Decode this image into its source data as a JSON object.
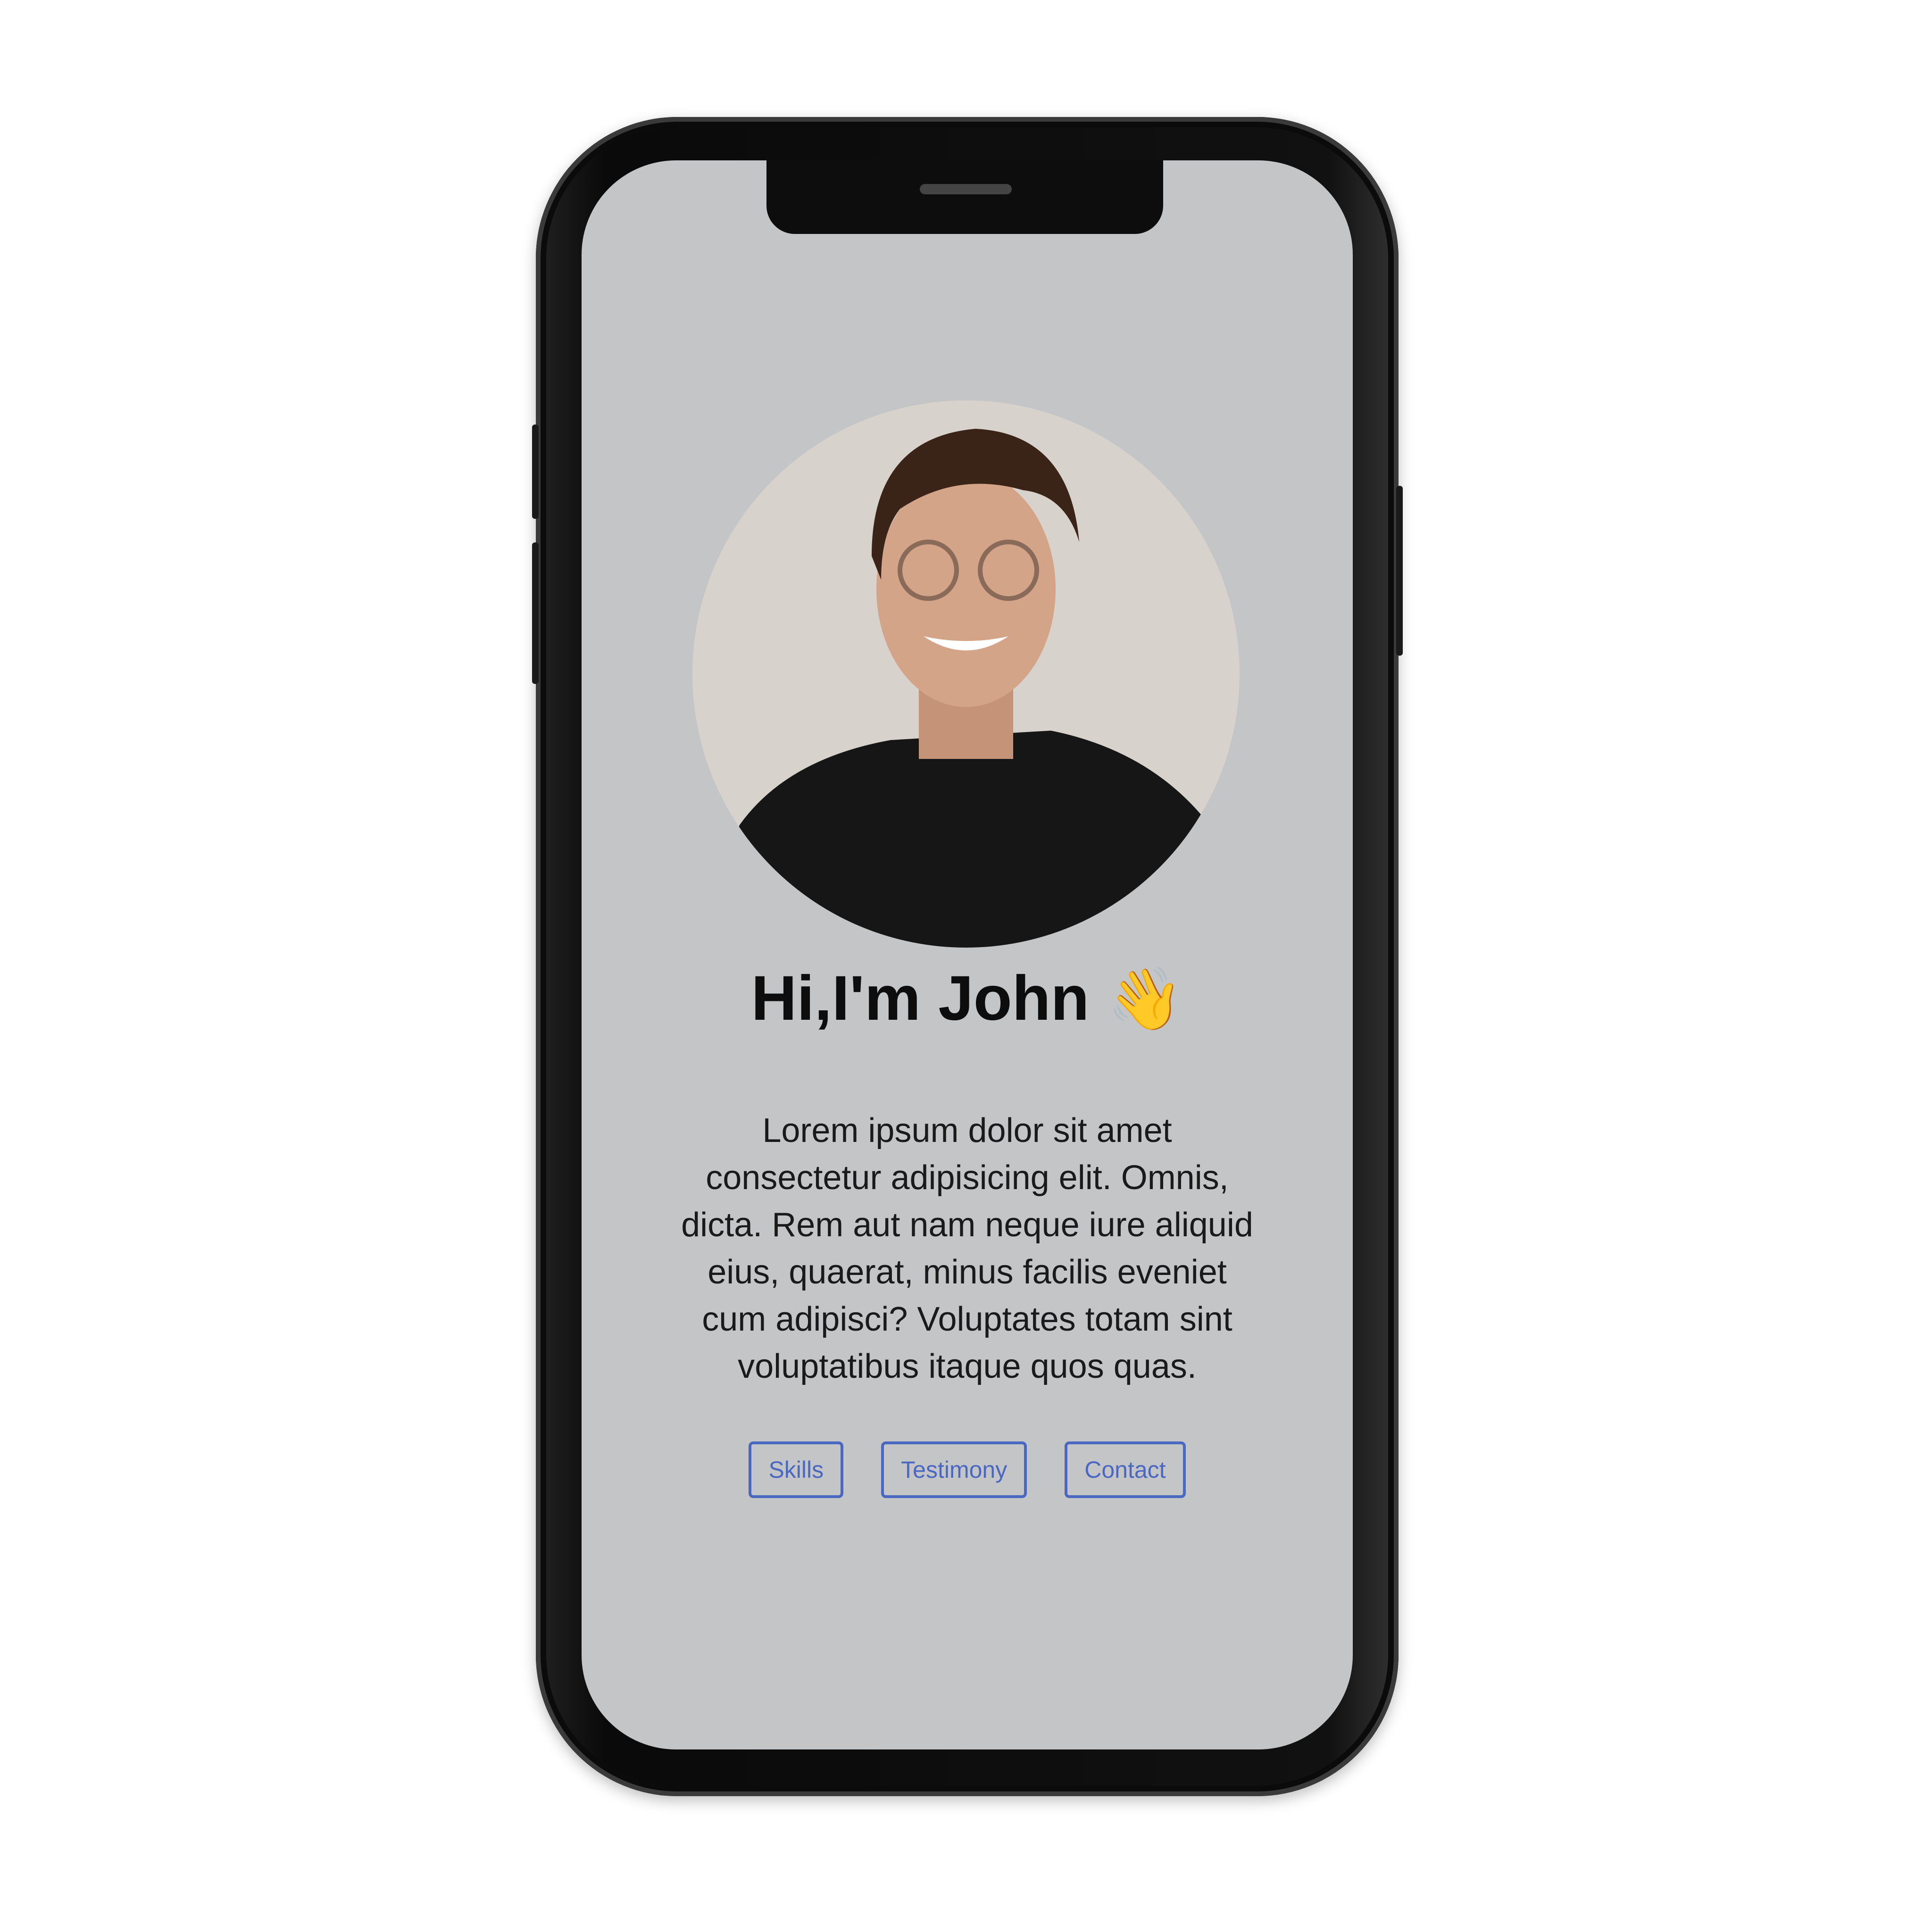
{
  "profile": {
    "heading": "Hi,I'm John",
    "wave_emoji": "👋",
    "bio": "Lorem ipsum dolor sit amet consectetur adipisicing elit. Omnis, dicta. Rem aut nam neque iure aliquid eius, quaerat, minus facilis eveniet cum adipisci? Voluptates totam sint voluptatibus itaque quos quas."
  },
  "nav": {
    "buttons": [
      {
        "label": "Skills"
      },
      {
        "label": "Testimony"
      },
      {
        "label": "Contact"
      }
    ]
  },
  "colors": {
    "screen_bg": "#c4c5c7",
    "accent": "#4a68c2"
  }
}
